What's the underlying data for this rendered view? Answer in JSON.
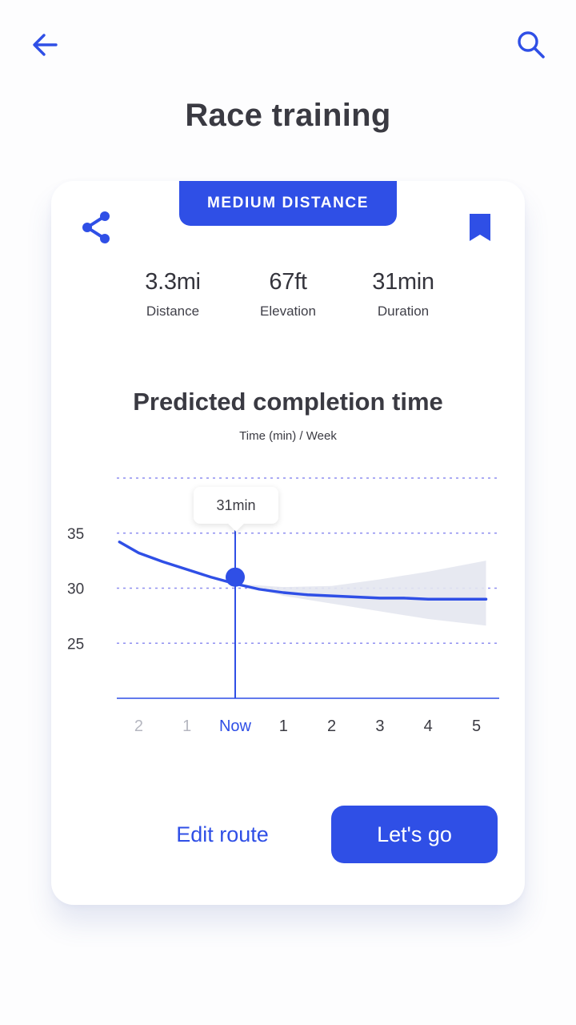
{
  "header": {
    "title": "Race training",
    "back_icon": "arrow-left-icon",
    "search_icon": "search-icon"
  },
  "card": {
    "category": "MEDIUM DISTANCE",
    "share_icon": "share-icon",
    "bookmark_icon": "bookmark-icon",
    "stats": [
      {
        "value": "3.3mi",
        "label": "Distance"
      },
      {
        "value": "67ft",
        "label": "Elevation"
      },
      {
        "value": "31min",
        "label": "Duration"
      }
    ],
    "chart": {
      "title": "Predicted completion time",
      "subtitle": "Time (min) / Week",
      "tooltip": "31min"
    },
    "actions": {
      "edit": "Edit route",
      "go": "Let's go"
    }
  },
  "colors": {
    "accent": "#2f4fe6",
    "text": "#3a3a42",
    "muted": "#b5b7c0",
    "grid": "#8f8ff0",
    "band": "#e4e7ef"
  },
  "chart_data": {
    "type": "line",
    "title": "Predicted completion time",
    "subtitle": "Time (min) / Week",
    "x_categories": [
      "2",
      "1",
      "Now",
      "1",
      "2",
      "3",
      "4",
      "5"
    ],
    "x_states": [
      "past",
      "past",
      "current",
      "future",
      "future",
      "future",
      "future",
      "future"
    ],
    "y_ticks": [
      25,
      30,
      35
    ],
    "ylim": [
      20,
      40
    ],
    "grid": "horizontal dotted",
    "series": [
      {
        "values": [
          34.2,
          33.2,
          32.4,
          31.7,
          31.0,
          30.4,
          29.9,
          29.6,
          29.4,
          29.3,
          29.2,
          29.1,
          29.1,
          29.0,
          29.0,
          29.0
        ],
        "x_pos": [
          -2.4,
          -2,
          -1.5,
          -1,
          -0.5,
          0,
          0.5,
          1,
          1.5,
          2,
          2.5,
          3,
          3.5,
          4,
          4.5,
          5.2
        ]
      }
    ],
    "uncertainty_band": {
      "x_pos": [
        0,
        1,
        2,
        3,
        4,
        5.2
      ],
      "upper": [
        30.4,
        30.1,
        30.2,
        30.8,
        31.5,
        32.5
      ],
      "lower": [
        30.4,
        29.3,
        28.6,
        27.9,
        27.2,
        26.6
      ]
    },
    "highlight": {
      "x": 0,
      "y": 31,
      "label": "31min"
    }
  }
}
